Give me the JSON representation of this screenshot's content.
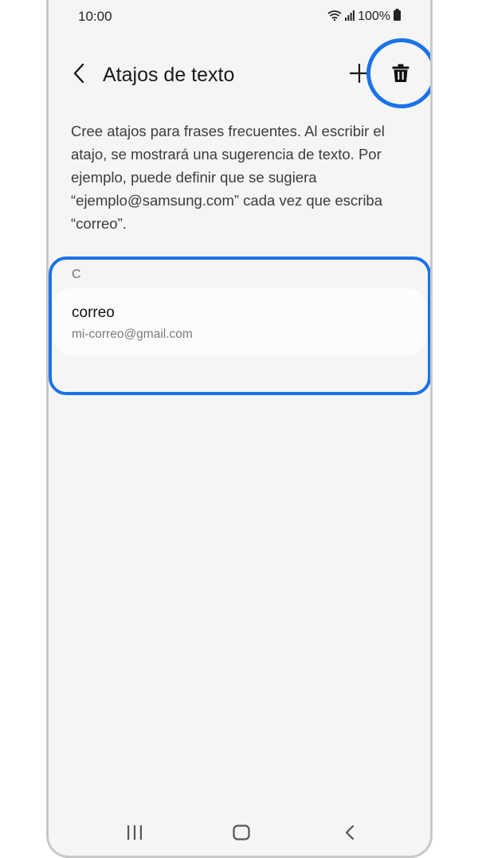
{
  "status_bar": {
    "time": "10:00",
    "battery_text": "100%"
  },
  "app_bar": {
    "title": "Atajos de texto",
    "back_icon": "chevron-left-icon",
    "add_icon": "plus-icon",
    "delete_icon": "trash-icon"
  },
  "description": {
    "text": "Cree atajos para frases frecuentes. Al escribir el atajo, se mostrará una sugerencia de texto. Por ejemplo, puede definir que se sugiera “ejemplo@samsung.com” cada vez que escriba “correo”."
  },
  "shortcuts": {
    "section_header": "C",
    "items": [
      {
        "title": "correo",
        "subtitle": "mi-correo@gmail.com"
      }
    ]
  },
  "colors": {
    "highlight": "#1a73e8",
    "background": "#f5f5f5",
    "card": "#fcfcfc"
  },
  "nav_bar": {
    "recents_icon": "recents-icon",
    "home_icon": "home-icon",
    "back_icon": "back-icon"
  }
}
